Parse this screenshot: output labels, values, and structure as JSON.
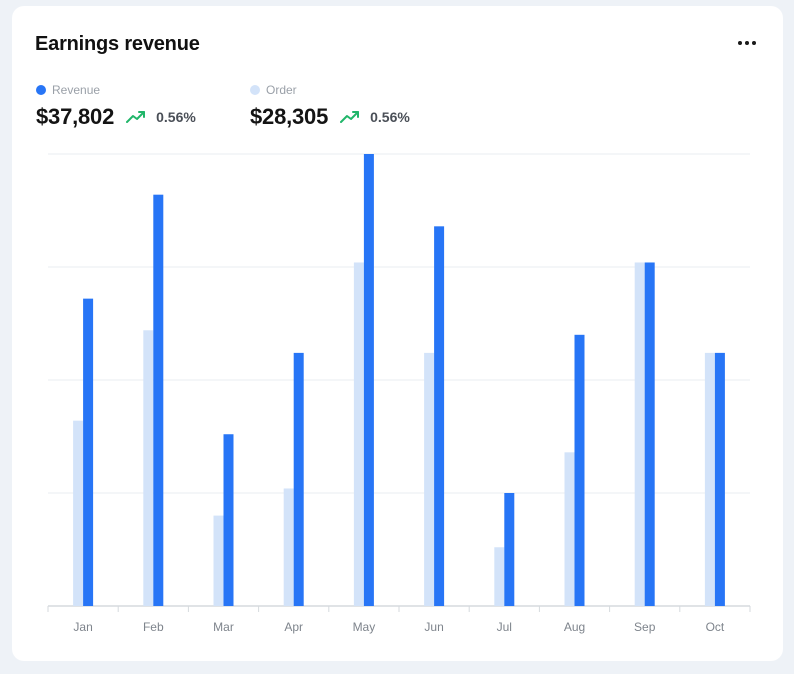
{
  "card": {
    "title": "Earnings revenue"
  },
  "stats": {
    "revenue": {
      "label": "Revenue",
      "value": "$37,802",
      "change": "0.56%"
    },
    "order": {
      "label": "Order",
      "value": "$28,305",
      "change": "0.56%"
    }
  },
  "icons": {
    "menu": "more-horizontal-icon",
    "trend": "trending-up-icon"
  },
  "colors": {
    "revenue": "#2775f6",
    "order": "#d3e3f9",
    "trend": "#21b66a",
    "grid": "#e9ecf0",
    "axis": "#d6dade"
  },
  "chart_data": {
    "type": "bar",
    "categories": [
      "Jan",
      "Feb",
      "Mar",
      "Apr",
      "May",
      "Jun",
      "Jul",
      "Aug",
      "Sep",
      "Oct"
    ],
    "series": [
      {
        "name": "Order",
        "values": [
          41,
          61,
          20,
          26,
          76,
          56,
          13,
          34,
          76,
          56
        ]
      },
      {
        "name": "Revenue",
        "values": [
          68,
          91,
          38,
          56,
          100,
          84,
          25,
          60,
          76,
          56
        ]
      }
    ],
    "ylim": [
      0,
      100
    ],
    "grid": true,
    "legend": "top-left"
  }
}
